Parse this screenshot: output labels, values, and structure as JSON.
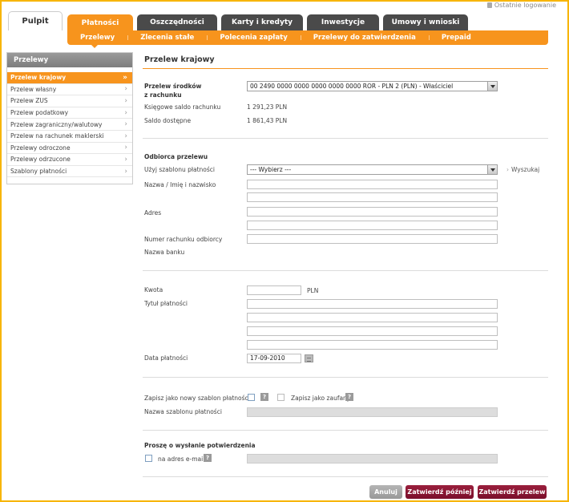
{
  "header": {
    "last_login": "Ostatnie logowanie",
    "home_tab": "Pulpit",
    "tabs": [
      "Płatności",
      "Oszczędności",
      "Karty i kredyty",
      "Inwestycje",
      "Umowy i wnioski"
    ],
    "subnav": [
      "Przelewy",
      "Zlecenia stałe",
      "Polecenia zapłaty",
      "Przelewy do zatwierdzenia",
      "Prepaid"
    ]
  },
  "sidebar": {
    "title": "Przelewy",
    "items": [
      {
        "label": "Przelew krajowy",
        "chev": "»"
      },
      {
        "label": "Przelew własny",
        "chev": "›"
      },
      {
        "label": "Przelew ZUS",
        "chev": "›"
      },
      {
        "label": "Przelew podatkowy",
        "chev": "›"
      },
      {
        "label": "Przelew zagraniczny/walutowy",
        "chev": "›"
      },
      {
        "label": "Przelew na rachunek maklerski",
        "chev": "›"
      },
      {
        "label": "Przelewy odroczone",
        "chev": "›"
      },
      {
        "label": "Przelewy odrzucone",
        "chev": "›"
      },
      {
        "label": "Szablony płatności",
        "chev": "›"
      }
    ]
  },
  "form": {
    "title": "Przelew krajowy",
    "source_label_1": "Przelew środków",
    "source_label_2": "z rachunku",
    "source_account": "00 2490 0000 0000 0000 0000 0000 ROR - PLN 2 (PLN)  - Właściciel",
    "booking_balance_label": "Księgowe saldo rachunku",
    "booking_balance": "1 291,23 PLN",
    "available_balance_label": "Saldo dostępne",
    "available_balance": "1 861,43 PLN",
    "recipient_section": "Odbiorca przelewu",
    "template_label": "Użyj szablonu płatności",
    "template_value": "--- Wybierz ---",
    "search_link": "Wyszukaj",
    "name_label": "Nazwa / Imię i nazwisko",
    "address_label": "Adres",
    "account_label": "Numer rachunku odbiorcy",
    "bank_label": "Nazwa banku",
    "amount_label": "Kwota",
    "currency": "PLN",
    "title_label": "Tytuł płatności",
    "date_label": "Data płatności",
    "date_value": "17-09-2010",
    "save_template_label": "Zapisz jako nowy szablon płatności",
    "save_trusted_label": "Zapisz jako zaufany",
    "template_name_label": "Nazwa szablonu płatności",
    "confirmation_section": "Proszę o wysłanie potwierdzenia",
    "email_label": "na adres e-mail",
    "help_glyph": "?"
  },
  "buttons": {
    "cancel": "Anuluj",
    "approve_later": "Zatwierdź później",
    "approve": "Zatwierdź przelew"
  },
  "colors": {
    "accent": "#f7941d",
    "border": "#f7b500",
    "button_primary": "#7a0f2c",
    "button_disabled": "#a8a8a8"
  }
}
